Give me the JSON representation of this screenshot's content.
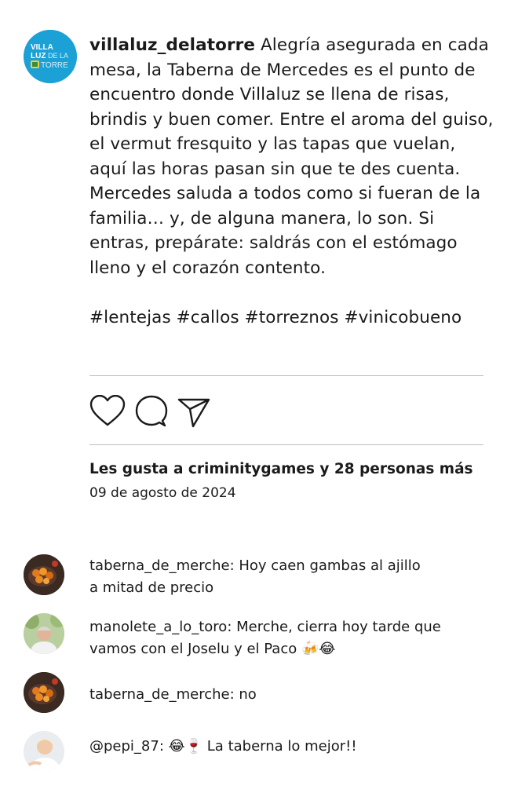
{
  "post": {
    "username": "villaluz_delatorre",
    "caption": "Alegría asegurada en cada mesa, la Taberna de Mercedes es el punto de encuentro donde Villaluz se llena de risas, brindis y buen comer. Entre el aroma del guiso, el vermut fresquito y las tapas que vuelan, aquí las horas pasan sin que te des cuenta. Mercedes saluda a todos como si fueran de la familia… y, de alguna manera, lo son. Si entras, prepárate: saldrás con el estómago lleno y el corazón contento.",
    "hashtags": "#lentejas #callos #torreznos #vinicobueno",
    "likes_text": "Les gusta a criminitygames y 28 personas más",
    "date": "09 de agosto de 2024",
    "avatar_logo": {
      "line1_a": "VILLA",
      "line2_a": "LUZ",
      "line2_b": "DE LA",
      "line3": "TORRE",
      "color": "#1ba1d6"
    }
  },
  "actions": {
    "like_icon": "heart-icon",
    "comment_icon": "comment-bubble-icon",
    "share_icon": "paper-plane-icon"
  },
  "comments": [
    {
      "line1": "taberna_de_merche: Hoy caen gambas al ajillo",
      "line2": "a mitad de precio",
      "avatar": "food"
    },
    {
      "line1": "manolete_a_lo_toro: Merche, cierra hoy tarde que",
      "line2": "vamos con el Joselu y el Paco 🍻😂",
      "avatar": "man"
    },
    {
      "line1": "taberna_de_merche: no",
      "line2": "",
      "avatar": "food"
    },
    {
      "line1": "@pepi_87: 😂🍷  La taberna lo mejor!!",
      "line2": "",
      "avatar": "woman"
    }
  ],
  "colors": {
    "divider": "#bdbdbd",
    "text": "#1a1a1a"
  }
}
